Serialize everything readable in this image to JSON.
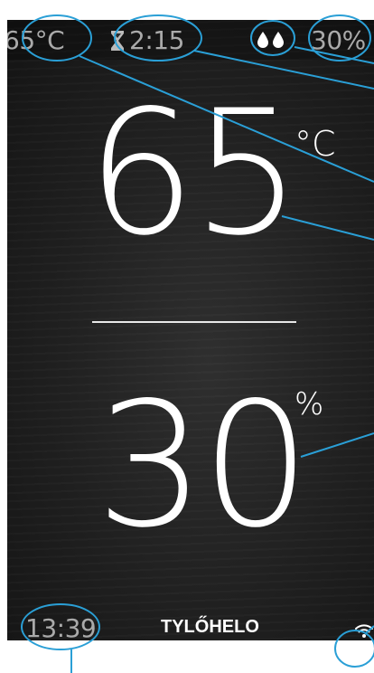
{
  "status_bar": {
    "temperature": "65°C",
    "timer": "2:15",
    "humidity": "30%",
    "icons": [
      "hourglass-icon",
      "humidity-drops-icon"
    ]
  },
  "main": {
    "temperature_value": "65",
    "temperature_unit": "°C",
    "humidity_value": "30",
    "humidity_unit": "%"
  },
  "footer": {
    "clock": "13:39",
    "brand": "TYLŐHELO",
    "icons": [
      "wifi-icon"
    ]
  },
  "annotation": {
    "color": "#2a9fd6"
  }
}
